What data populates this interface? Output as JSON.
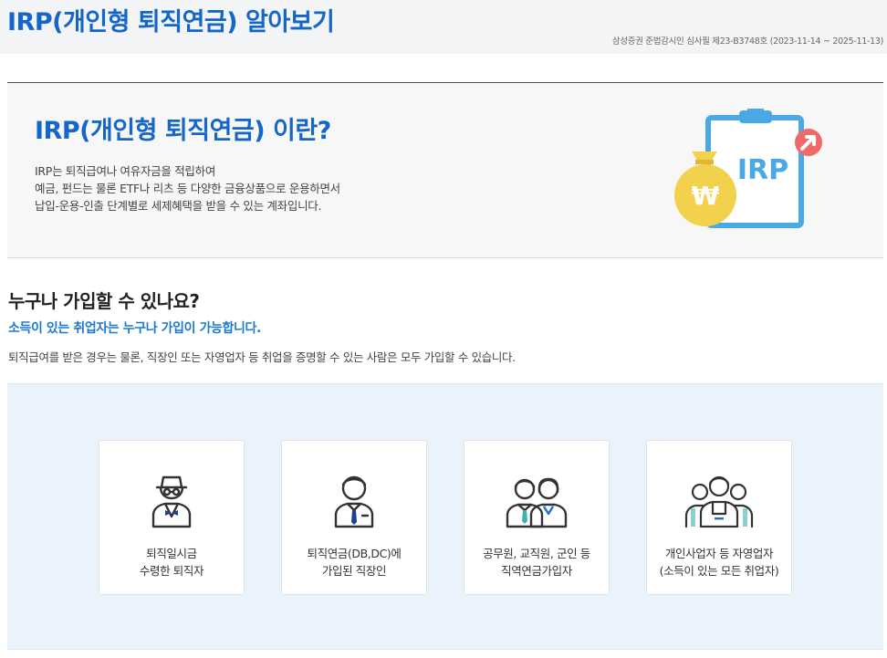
{
  "header": {
    "title": "IRP(개인형 퇴직연금) 알아보기",
    "review_note": "삼성증권 준법감시인 심사필 제23-B3748호 (2023-11-14 ~ 2025-11-13)"
  },
  "intro": {
    "title": "IRP(개인형 퇴직연금) 이란?",
    "description_lines": [
      "IRP는 퇴직급여나 여유자금을 적립하여",
      "예금, 펀드는 물론 ETF나 리츠 등 다양한 금융상품으로 운용하면서",
      "납입-운용-인출 단계별로 세제혜택을 받을 수 있는 계좌입니다."
    ],
    "illustration": {
      "board_text": "IRP",
      "coin_symbol": "₩",
      "icon": "clipboard-with-money-bag-icon"
    }
  },
  "who": {
    "title": "누구나 가입할 수 있나요?",
    "subtitle": "소득이 있는 취업자는 누구나 가입이 가능합니다.",
    "description": "퇴직급여를 받은 경우는 물론, 직장인 또는 자영업자 등 취업을 증명할 수 있는 사람은 모두 가입할 수 있습니다."
  },
  "eligible": [
    {
      "icon": "retiree-icon",
      "lines": [
        "퇴직일시금",
        "수령한 퇴직자"
      ]
    },
    {
      "icon": "office-worker-icon",
      "lines": [
        "퇴직연금(DB,DC)에",
        "가입된 직장인"
      ]
    },
    {
      "icon": "public-servants-icon",
      "lines": [
        "공무원, 교직원, 군인 등",
        "직역연금가입자"
      ]
    },
    {
      "icon": "self-employed-group-icon",
      "lines": [
        "개인사업자 등 자영업자",
        "(소득이 있는 모든 취업자)"
      ]
    }
  ],
  "colors": {
    "accent": "#1466c8",
    "subtitle": "#1b7ad0",
    "panel_bg": "#eaf3fb",
    "illust_blue": "#4aa8e4",
    "illust_gold": "#f2d24d",
    "illust_red": "#ef6b6b",
    "icon_line": "#333333",
    "tie_navy": "#1f3f8f",
    "tie_teal": "#3bb3b0"
  }
}
